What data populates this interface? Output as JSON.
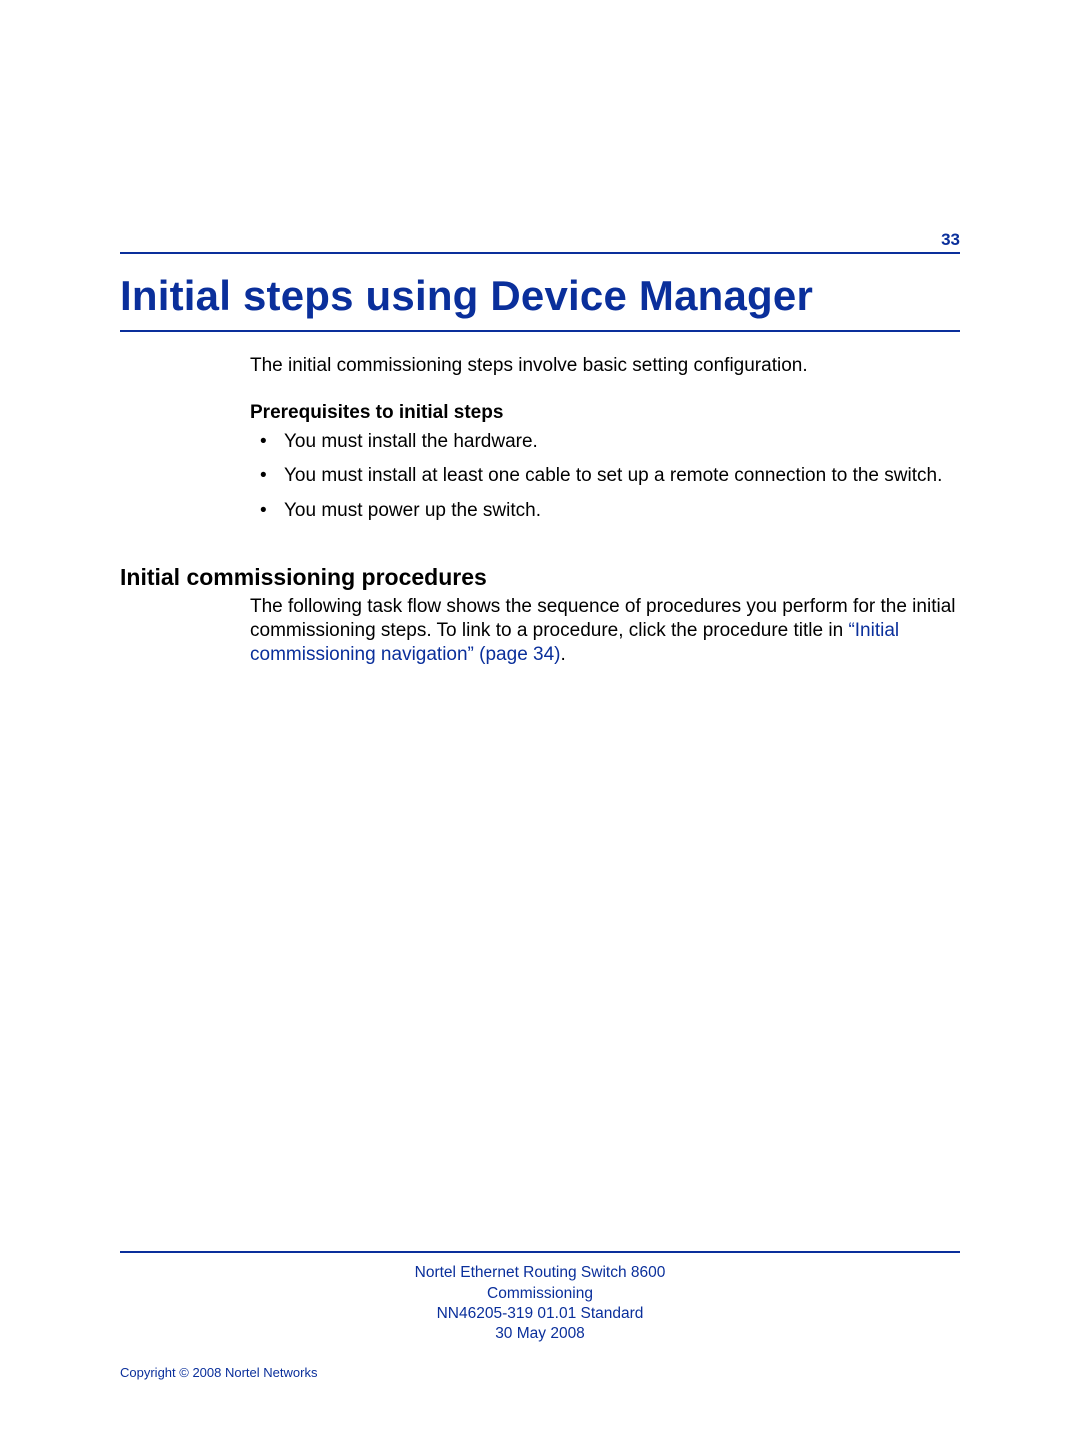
{
  "page_number": "33",
  "chapter_title": "Initial steps using Device Manager",
  "intro": "The initial commissioning steps involve basic setting configuration.",
  "prereq_heading": "Prerequisites to initial steps",
  "prereq_items": [
    "You must install the hardware.",
    "You must install at least one cable to set up a remote connection to the switch.",
    "You must power up the switch."
  ],
  "section_heading": "Initial commissioning procedures",
  "proc_text_before_link": "The following task flow shows the sequence of procedures you perform for the initial commissioning steps. To link to a procedure, click the procedure title in ",
  "proc_link_text": "“Initial commissioning navigation” (page 34)",
  "proc_text_after_link": ".",
  "footer": {
    "line1": "Nortel Ethernet Routing Switch 8600",
    "line2": "Commissioning",
    "line3": "NN46205-319   01.01   Standard",
    "line4": "30 May 2008",
    "copyright": "Copyright © 2008 Nortel Networks"
  }
}
